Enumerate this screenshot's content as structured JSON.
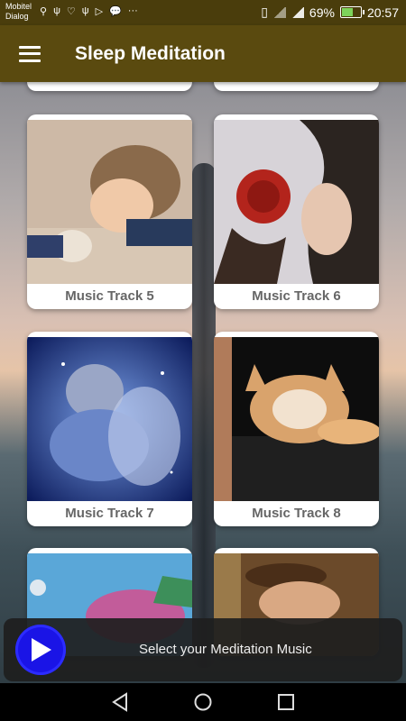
{
  "status_bar": {
    "carrier_line1": "Mobitel",
    "carrier_line2": "Dialog",
    "notification_glyphs": [
      "⚲",
      "ψ",
      "♡",
      "ψ",
      "▷",
      "💬",
      "···"
    ],
    "battery": "69%",
    "battery_level": 0.69,
    "time": "20:57"
  },
  "app_bar": {
    "title": "Sleep Meditation"
  },
  "tracks": [
    {
      "label": "Music Track 5"
    },
    {
      "label": "Music Track 6"
    },
    {
      "label": "Music Track 7"
    },
    {
      "label": "Music Track 8"
    }
  ],
  "player": {
    "prompt": "Select your Meditation Music"
  },
  "colors": {
    "status_bar": "#4a3d0c",
    "app_bar": "#5a4a0f",
    "play_button": "#1a14e6"
  }
}
